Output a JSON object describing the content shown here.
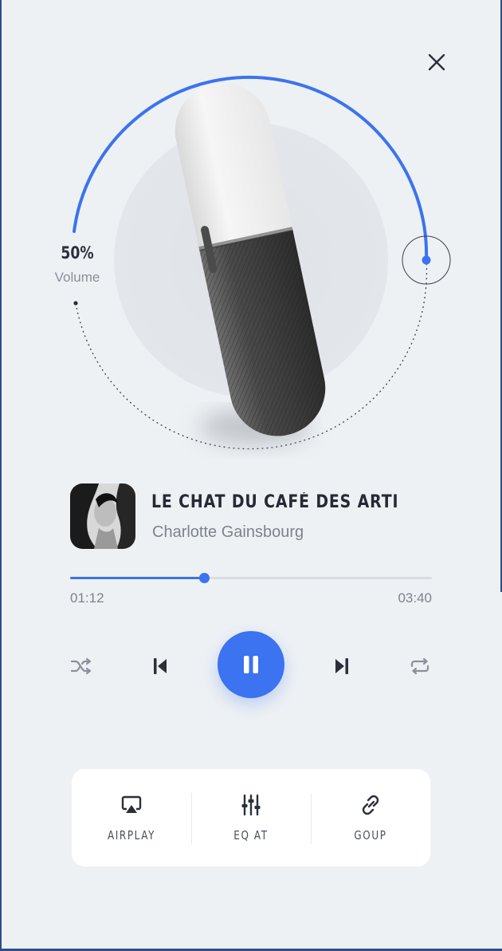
{
  "volume": {
    "percent_label": "50%",
    "label": "Volume",
    "level": 0.5
  },
  "track": {
    "title": "LE CHAT DU CAFÉ DES ARTISTES (O...",
    "artist": "Charlotte Gainsbourg",
    "elapsed": "01:12",
    "duration": "03:40",
    "progress": 0.37
  },
  "actions": [
    {
      "label": "AIRPLAY",
      "icon": "airplay-icon"
    },
    {
      "label": "EQ AT",
      "icon": "equalizer-icon"
    },
    {
      "label": "GOUP",
      "icon": "link-icon"
    }
  ],
  "colors": {
    "accent": "#3b73f0",
    "background": "#eef1f4",
    "text": "#252a34"
  }
}
